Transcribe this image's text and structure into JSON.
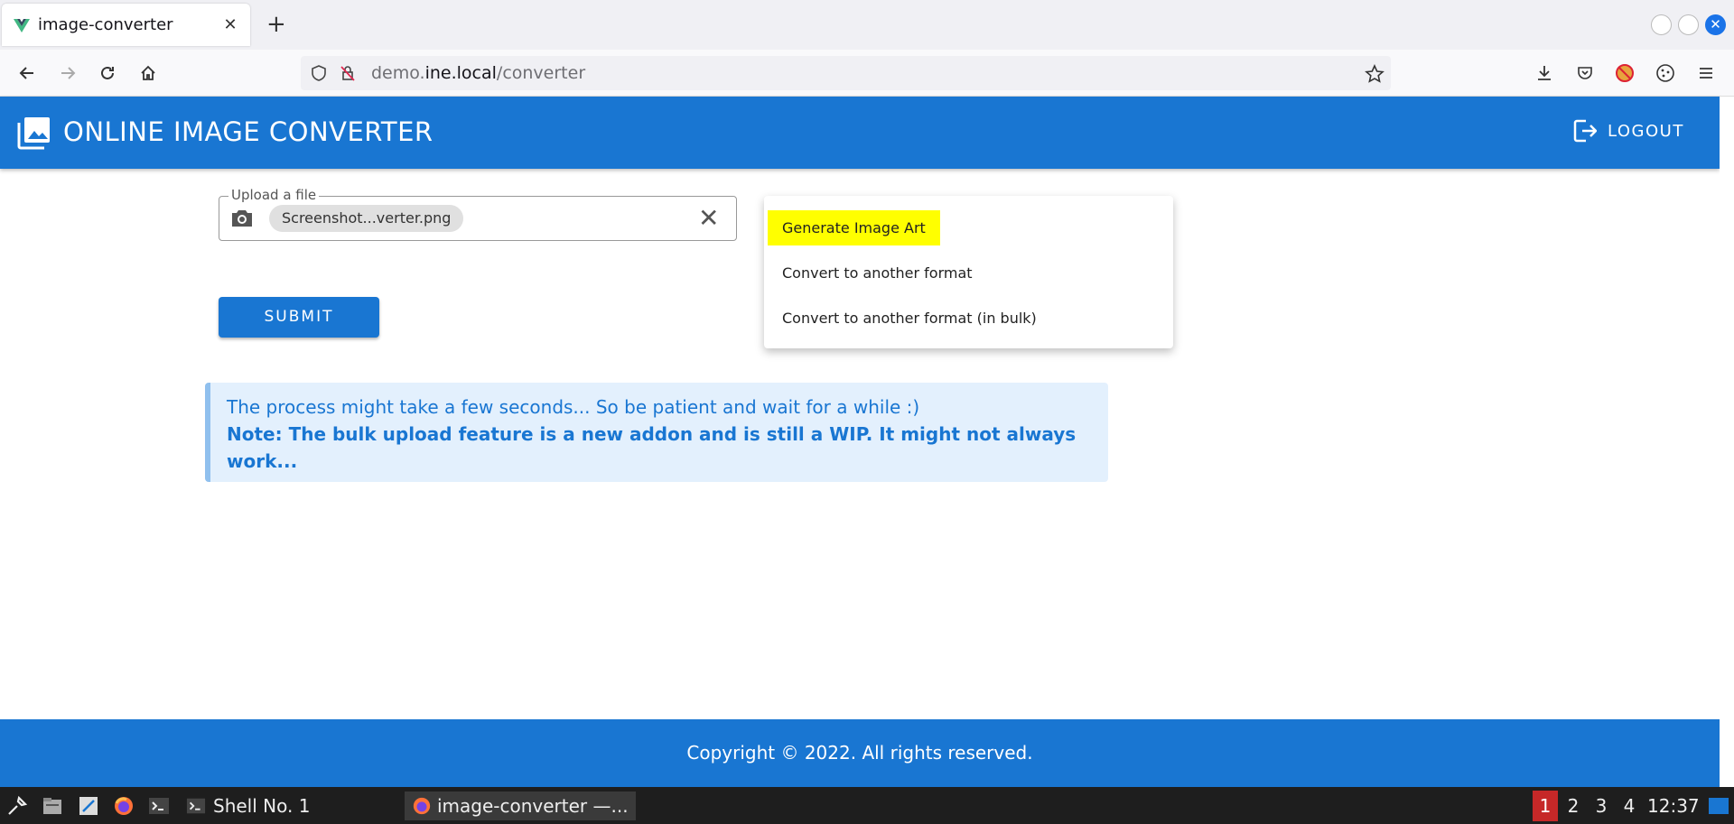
{
  "browser": {
    "tab_title": "image-converter",
    "new_tab_symbol": "+",
    "url_host_prefix": "demo.",
    "url_host_main": "ine.local",
    "url_path": "/converter"
  },
  "app": {
    "title": "ONLINE IMAGE CONVERTER",
    "logout_label": "LOGOUT",
    "accent_color": "#1976d2"
  },
  "form": {
    "upload_legend": "Upload a file",
    "file_chip": "Screenshot...verter.png",
    "submit_label": "SUBMIT"
  },
  "menu": {
    "items": [
      {
        "label": "Generate Image Art",
        "highlighted": true
      },
      {
        "label": "Convert to another format"
      },
      {
        "label": "Convert to another format (in bulk)"
      }
    ]
  },
  "alert": {
    "line1": "The process might take a few seconds... So be patient and wait for a while :)",
    "line2": "Note: The bulk upload feature is a new addon and is still a WIP. It might not always work..."
  },
  "footer": {
    "copyright": "Copyright © 2022. All rights reserved."
  },
  "taskbar": {
    "task_shell": "Shell No. 1",
    "task_browser": "image-converter —...",
    "workspaces": [
      "1",
      "2",
      "3",
      "4"
    ],
    "active_workspace": "1",
    "clock": "12:37"
  }
}
